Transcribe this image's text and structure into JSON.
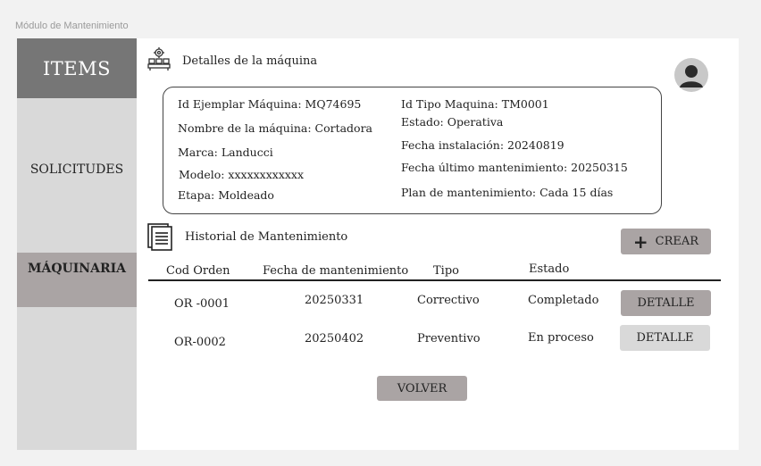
{
  "frame_label": "Módulo de Mantenimiento",
  "sidebar": {
    "items": [
      {
        "label": "ITEMS"
      },
      {
        "label": "SOLICITUDES"
      },
      {
        "label": "MÁQUINARIA"
      }
    ]
  },
  "machine": {
    "section_title": "Detalles de la máquina",
    "icon": "machine-icon",
    "left": [
      "Id Ejemplar Máquina: MQ74695",
      "Nombre de la máquina: Cortadora",
      "Marca: Landucci",
      "Modelo: xxxxxxxxxxxx",
      "Etapa: Moldeado"
    ],
    "right": [
      "Id Tipo Maquina: TM0001",
      "Estado: Operativa",
      "Fecha instalación: 20240819",
      "Fecha último mantenimiento: 20250315",
      "Plan de mantenimiento: Cada 15 días"
    ]
  },
  "history": {
    "section_title": "Historial de Mantenimiento",
    "icon": "document-icon",
    "create_button": "CREAR",
    "columns": [
      "Cod Orden",
      "Fecha de mantenimiento",
      "Tipo",
      "Estado"
    ],
    "rows": [
      {
        "cod": "OR -0001",
        "fecha": "20250331",
        "tipo": "Correctivo",
        "estado": "Completado",
        "action": "DETALLE"
      },
      {
        "cod": "OR-0002",
        "fecha": "20250402",
        "tipo": "Preventivo",
        "estado": "En proceso",
        "action": "DETALLE"
      }
    ]
  },
  "back_button": "VOLVER",
  "colors": {
    "sidebar": "#d9d9d9",
    "sidebar_active_top": "#767676",
    "button": "#aaa4a4",
    "button_light": "#d9d9d9"
  }
}
